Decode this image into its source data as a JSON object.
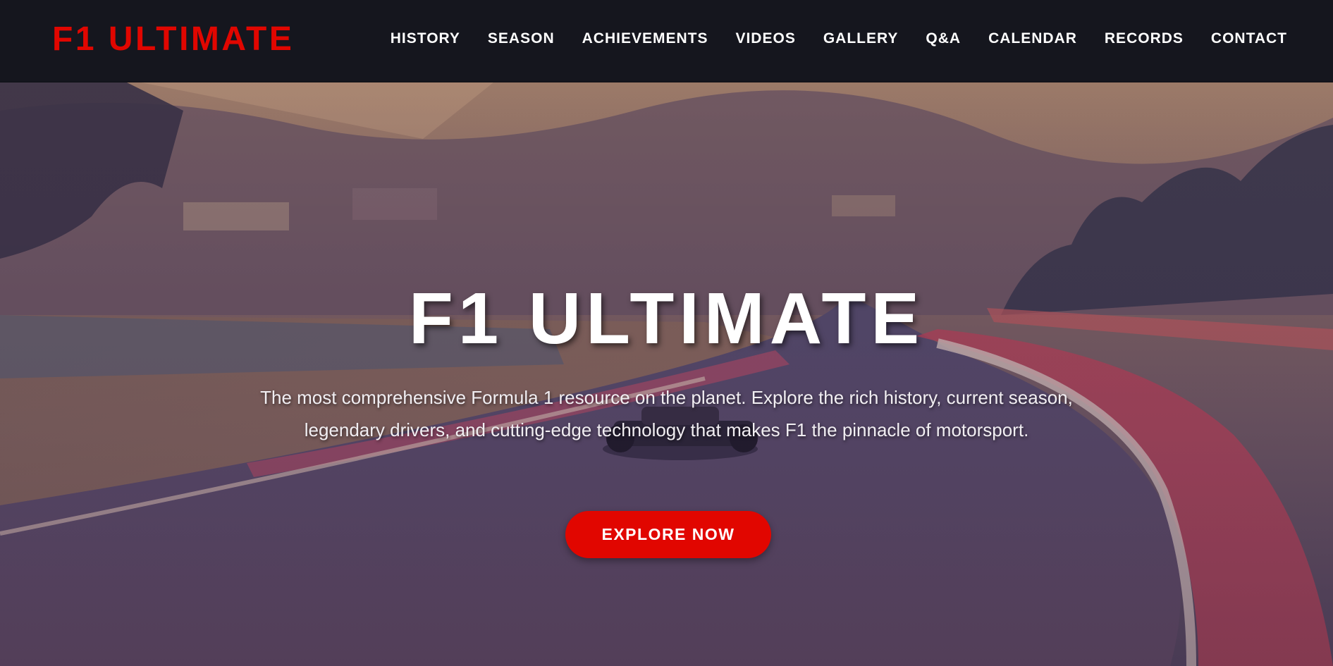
{
  "brand": {
    "logo": "F1 ULTIMATE",
    "accent": "#e10600"
  },
  "nav": {
    "items": [
      "HISTORY",
      "SEASON",
      "ACHIEVEMENTS",
      "VIDEOS",
      "GALLERY",
      "Q&A",
      "CALENDAR",
      "RECORDS",
      "CONTACT"
    ]
  },
  "hero": {
    "title": "F1 ULTIMATE",
    "description": "The most comprehensive Formula 1 resource on the planet. Explore the rich history, current season, legendary drivers, and cutting-edge technology that makes F1 the pinnacle of motorsport.",
    "cta_label": "EXPLORE NOW"
  }
}
